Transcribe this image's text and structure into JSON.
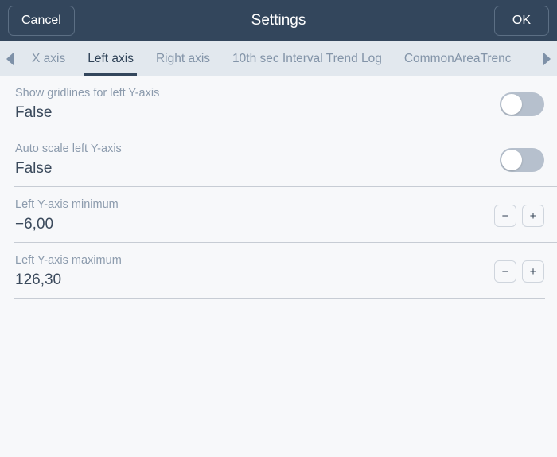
{
  "header": {
    "cancel_label": "Cancel",
    "title": "Settings",
    "ok_label": "OK",
    "background_color": "#33465c"
  },
  "tabbar": {
    "background_color": "#e2e8ee",
    "prev_arrow_icon": "triangle-left-icon",
    "next_arrow_icon": "triangle-right-icon",
    "active_index": 1,
    "active_underline_color": "#33465c",
    "tabs": [
      {
        "label": "X axis",
        "active": false
      },
      {
        "label": "Left axis",
        "active": true
      },
      {
        "label": "Right axis",
        "active": false
      },
      {
        "label": "10th sec Interval Trend Log",
        "active": false
      },
      {
        "label": "CommonAreaTrenc",
        "active": false
      }
    ]
  },
  "settings": {
    "rows": [
      {
        "label": "Show gridlines for left Y-axis",
        "value": "False",
        "control": "toggle",
        "toggle_on": false
      },
      {
        "label": "Auto scale left Y-axis",
        "value": "False",
        "control": "toggle",
        "toggle_on": false
      },
      {
        "label": "Left Y-axis minimum",
        "value": "−6,00",
        "control": "stepper",
        "decrement_label": "−",
        "increment_label": "+"
      },
      {
        "label": "Left Y-axis maximum",
        "value": "126,30",
        "control": "stepper",
        "decrement_label": "−",
        "increment_label": "+"
      }
    ]
  },
  "colors": {
    "header_bg": "#33465c",
    "tabbar_bg": "#e2e8ee",
    "content_bg": "#f7f8fa",
    "label_text": "#8c9bad",
    "value_text": "#3b4a5c",
    "divider": "#c7ccd4",
    "toggle_track_off": "#b6c0cd"
  }
}
